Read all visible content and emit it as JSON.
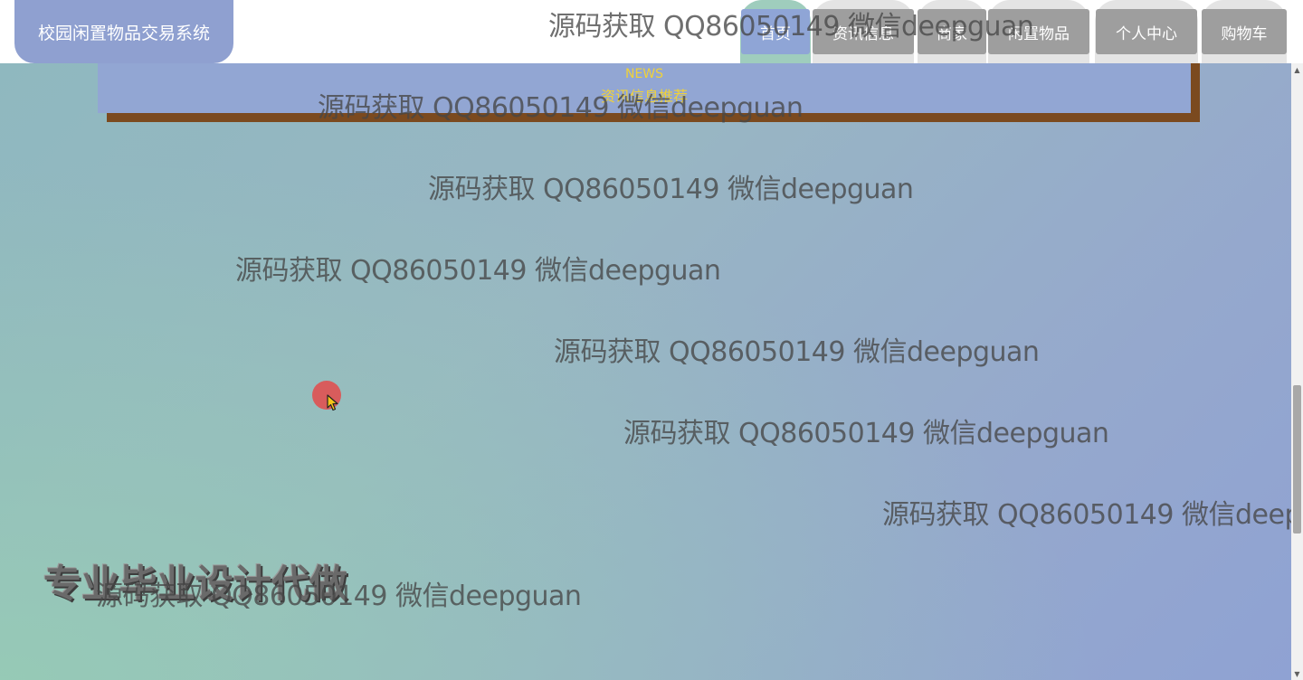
{
  "brand": {
    "title": "校园闲置物品交易系统"
  },
  "nav": {
    "items": [
      {
        "label": "首页",
        "active": true
      },
      {
        "label": "资讯信息",
        "active": false
      },
      {
        "label": "商家",
        "active": false
      },
      {
        "label": "闲置物品",
        "active": false
      },
      {
        "label": "个人中心",
        "active": false
      },
      {
        "label": "购物车",
        "active": false
      }
    ]
  },
  "news": {
    "title_en": "NEWS",
    "title_cn": "资讯信息推荐"
  },
  "promo": {
    "text": "专业毕业设计代做"
  },
  "watermark": {
    "text": "源码获取 QQ86050149 微信deepguan"
  },
  "colors": {
    "brand_bg": "#8fa0d0",
    "nav_tab_bg": "#e4e4e4",
    "nav_active_tab_bg": "#9fcdbd",
    "nav_pill_bg": "#9e9e9e",
    "nav_active_pill_bg": "#8fa5d6",
    "news_border": "#7b4a1f",
    "news_text": "#f0d23a",
    "cursor_highlight": "#d85c5c"
  },
  "icons": {
    "cursor": "mouse-cursor-icon",
    "scroll_up": "scroll-up-arrow-icon",
    "scroll_down": "scroll-down-arrow-icon"
  }
}
